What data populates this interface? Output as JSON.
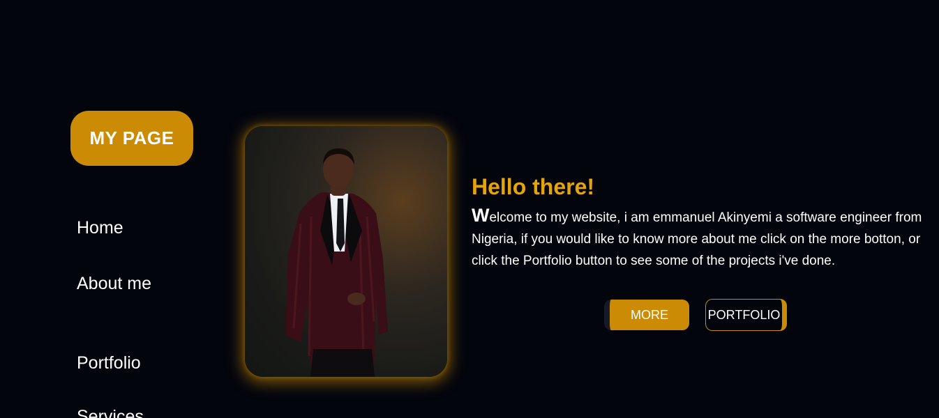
{
  "brand": {
    "label": "MY PAGE"
  },
  "nav": {
    "items": [
      {
        "label": "Home"
      },
      {
        "label": "About me"
      },
      {
        "label": "Portfolio"
      },
      {
        "label": "Services"
      }
    ]
  },
  "hero": {
    "title": "Hello there!",
    "intro_first_letter": "W",
    "intro_rest": "elcome to my website, i am emmanuel Akinyemi a software engineer from Nigeria, if you would like to know more about me click on the more botton, or click the Portfolio button to see some of the projects i've done.",
    "more_label": "MORE",
    "portfolio_label": "PORTFOLIO"
  },
  "colors": {
    "background": "#03050d",
    "accent": "#cc8b05",
    "title": "#e5a50a",
    "text": "#ffffff"
  }
}
